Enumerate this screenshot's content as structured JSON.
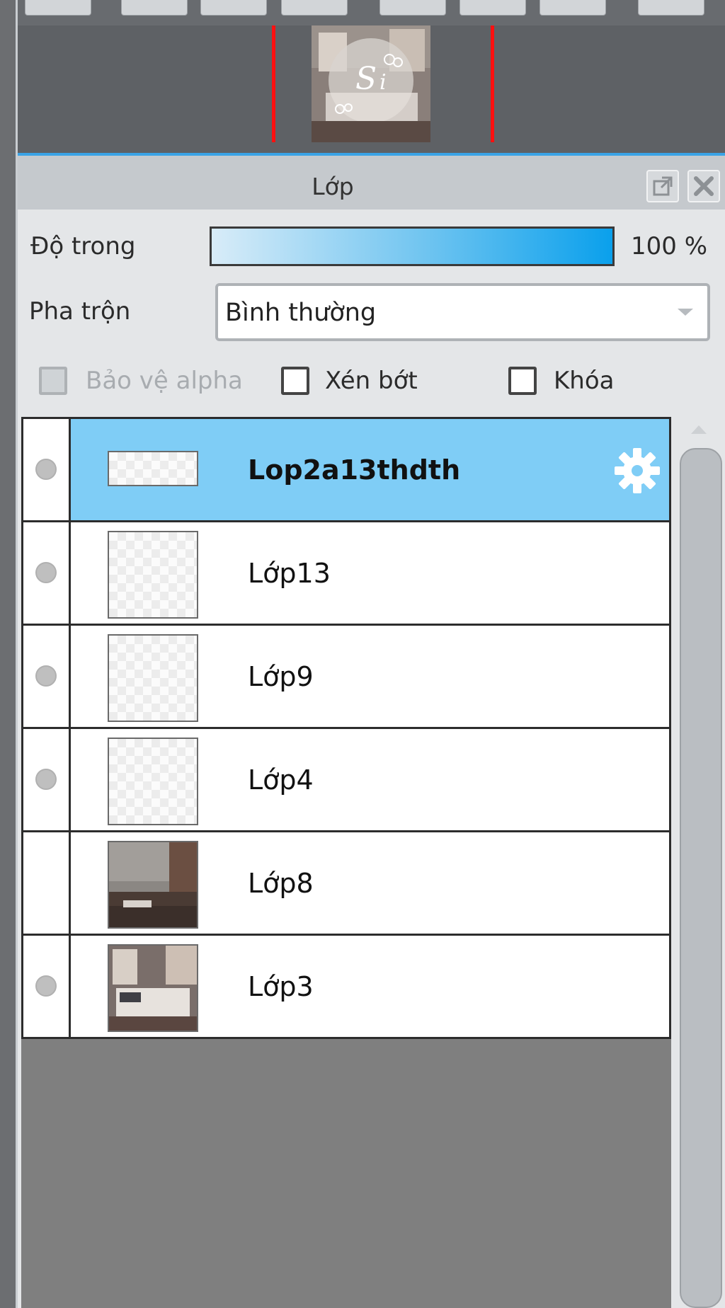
{
  "panel": {
    "title": "Lớp",
    "opacity": {
      "label": "Độ trong",
      "value": "100 %",
      "fraction": 1.0
    },
    "blend": {
      "label": "Pha trộn",
      "selected": "Bình thường"
    },
    "checkboxes": {
      "protect_alpha": {
        "label": "Bảo vệ alpha",
        "checked": false,
        "enabled": false
      },
      "clip": {
        "label": "Xén bớt",
        "checked": false,
        "enabled": true
      },
      "lock": {
        "label": "Khóa",
        "checked": false,
        "enabled": true
      }
    }
  },
  "layers": [
    {
      "name": "Lop2a13thdth",
      "active": true,
      "visible": true
    },
    {
      "name": "Lớp13",
      "active": false,
      "visible": true
    },
    {
      "name": "Lớp9",
      "active": false,
      "visible": true
    },
    {
      "name": "Lớp4",
      "active": false,
      "visible": true
    },
    {
      "name": "Lớp8",
      "active": false,
      "visible": false
    },
    {
      "name": "Lớp3",
      "active": false,
      "visible": true
    }
  ],
  "colors": {
    "accent": "#3aa3e6",
    "selection": "#7fcdf6",
    "nav_frame": "#ff1010"
  }
}
